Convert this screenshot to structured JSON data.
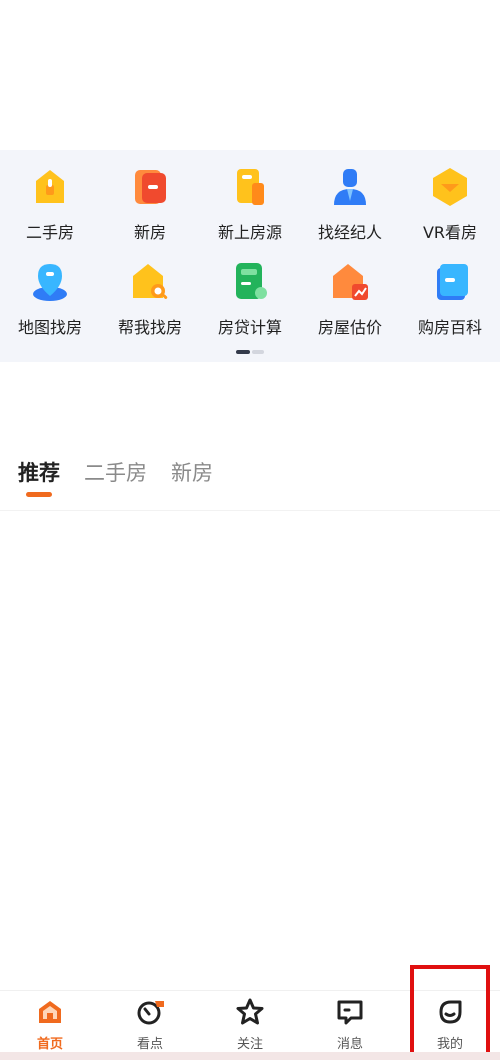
{
  "quick_grid": {
    "row1": [
      {
        "label": "二手房",
        "icon": "secondhand-house-icon"
      },
      {
        "label": "新房",
        "icon": "new-house-icon"
      },
      {
        "label": "新上房源",
        "icon": "new-listing-icon"
      },
      {
        "label": "找经纪人",
        "icon": "agent-icon"
      },
      {
        "label": "VR看房",
        "icon": "vr-icon"
      }
    ],
    "row2": [
      {
        "label": "地图找房",
        "icon": "map-pin-icon"
      },
      {
        "label": "帮我找房",
        "icon": "house-search-icon"
      },
      {
        "label": "房贷计算",
        "icon": "calculator-icon"
      },
      {
        "label": "房屋估价",
        "icon": "valuation-icon"
      },
      {
        "label": "购房百科",
        "icon": "encyclopedia-icon"
      }
    ]
  },
  "tabs": [
    {
      "label": "推荐",
      "active": true
    },
    {
      "label": "二手房",
      "active": false
    },
    {
      "label": "新房",
      "active": false
    }
  ],
  "bottom_nav": [
    {
      "label": "首页",
      "icon": "home-icon",
      "active": true
    },
    {
      "label": "看点",
      "icon": "compass-icon",
      "active": false
    },
    {
      "label": "关注",
      "icon": "star-icon",
      "active": false
    },
    {
      "label": "消息",
      "icon": "message-icon",
      "active": false
    },
    {
      "label": "我的",
      "icon": "profile-icon",
      "active": false
    }
  ],
  "colors": {
    "accent": "#f06a1e",
    "panel_bg": "#f3f5fa",
    "highlight_border": "#e01010"
  }
}
